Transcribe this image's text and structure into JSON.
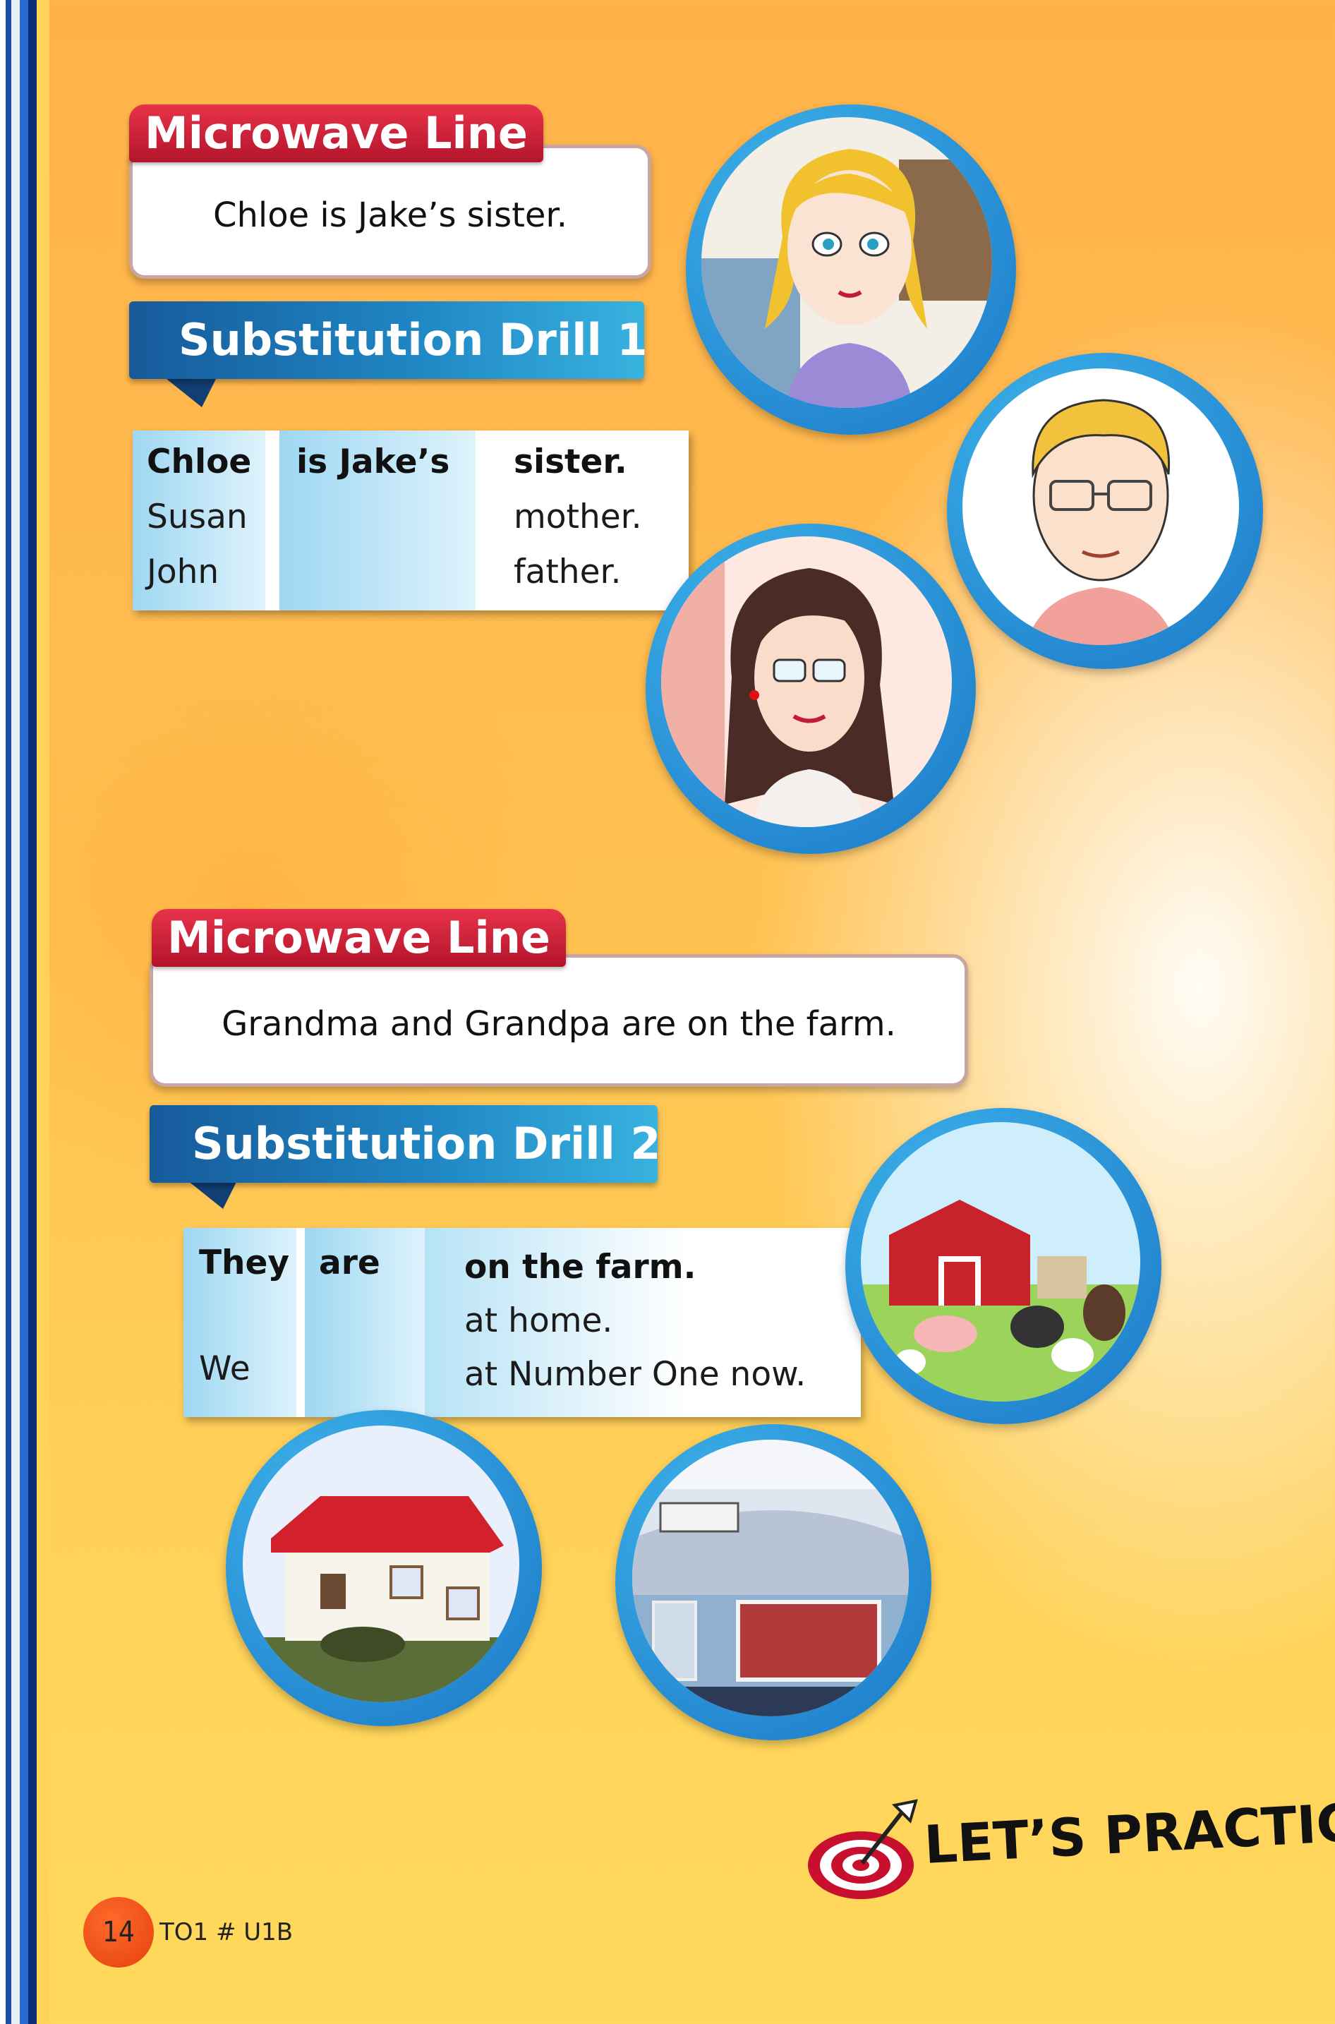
{
  "section1": {
    "microwave_label": "Microwave Line",
    "microwave_text": "Chloe is Jake’s sister.",
    "drill_label": "Substitution Drill 1",
    "table": {
      "col1": [
        "Chloe",
        "Susan",
        "John"
      ],
      "col2": [
        "is Jake’s"
      ],
      "col3": [
        "sister.",
        "mother.",
        "father."
      ]
    }
  },
  "section2": {
    "microwave_label": "Microwave Line",
    "microwave_text": "Grandma and Grandpa are on the farm.",
    "drill_label": "Substitution Drill 2",
    "table": {
      "col1": [
        "They",
        "We"
      ],
      "col2": [
        "are"
      ],
      "col3": [
        "on the farm.",
        "at home.",
        "at Number One now."
      ]
    }
  },
  "footer": {
    "page_number": "14",
    "code": "TO1 # U1B",
    "lets_practice": "LET’S PRACTICE"
  },
  "illustrations": {
    "chloe": "girl-portrait",
    "father": "man-portrait",
    "mother": "woman-portrait",
    "farm": "farm-scene",
    "home": "house-photo",
    "school": "number-one-building-photo"
  },
  "colors": {
    "microwave_red": "#c81d35",
    "drill_blue": "#1f86c3",
    "circle_blue": "#1a76c6"
  }
}
